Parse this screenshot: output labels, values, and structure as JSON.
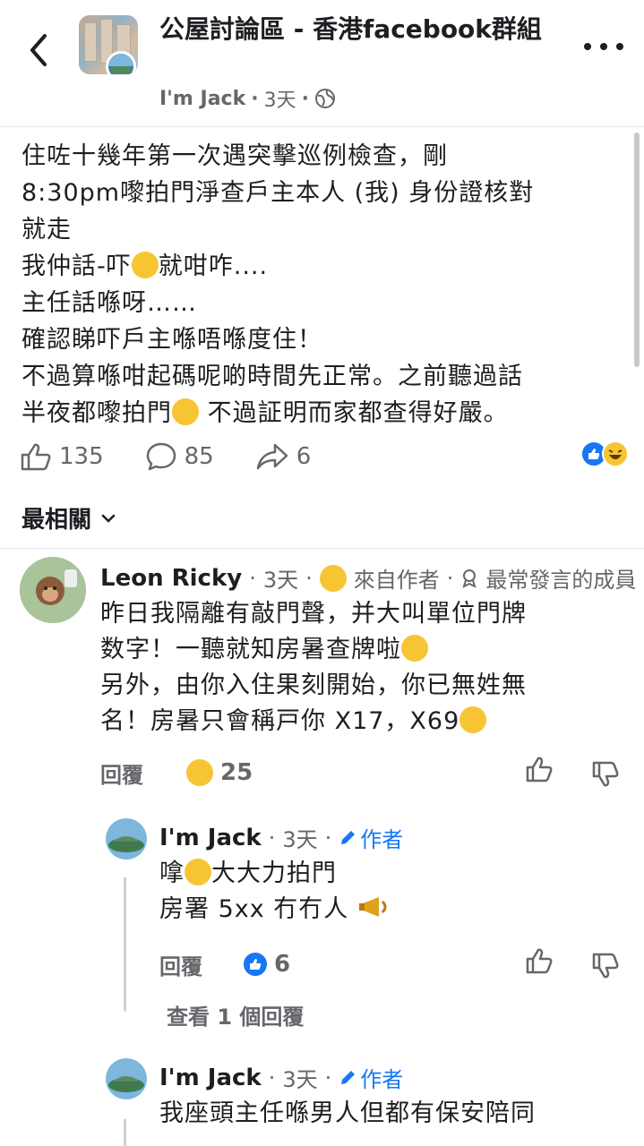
{
  "header": {
    "group_title": "公屋討論區 - 香港facebook群組",
    "author": "I'm Jack",
    "time": "3天",
    "separator": "·"
  },
  "post": {
    "lines": [
      "住咗十幾年第一次遇突擊巡例檢查，剛",
      "8:30pm嚟拍門淨查戶主本人 (我) 身份證核對",
      "就走",
      "我仲話-吓",
      "就咁咋....",
      "主任話喺呀……",
      "確認睇吓戶主喺唔喺度住！",
      "不過算喺咁起碼呢啲時間先正常。之前聽過話",
      "半夜都嚟拍門",
      "不過証明而家都查得好嚴。"
    ]
  },
  "actions": {
    "likes": "135",
    "comments": "85",
    "shares": "6"
  },
  "sort": {
    "label": "最相關"
  },
  "comments": [
    {
      "name": "Leon Ricky",
      "time": "3天",
      "from_author": "來自作者",
      "badge": "最常發言的成員",
      "lines": [
        "昨日我隔離有敲門聲，并大叫單位門牌",
        "数字！一聽就知房暑查牌啦",
        "另外，由你入住果刻開始，你已無姓無",
        "名！房暑只會稱戸你 X17，X69"
      ],
      "reply_label": "回覆",
      "reaction_count": "25"
    },
    {
      "name": "I'm Jack",
      "time": "3天",
      "author_badge": "作者",
      "lines": [
        "嗱",
        "大大力拍門",
        "房署 5xx 冇冇人"
      ],
      "reply_label": "回覆",
      "reaction_count": "6",
      "view_replies": "查看 1 個回覆"
    },
    {
      "name": "I'm Jack",
      "time": "3天",
      "author_badge": "作者",
      "lines": [
        "我座頭主任喺男人但都有保安陪同"
      ]
    }
  ],
  "colors": {
    "accent": "#1877f2",
    "text": "#1c1e21",
    "muted": "#65676b",
    "emoji": "#f7c534"
  }
}
